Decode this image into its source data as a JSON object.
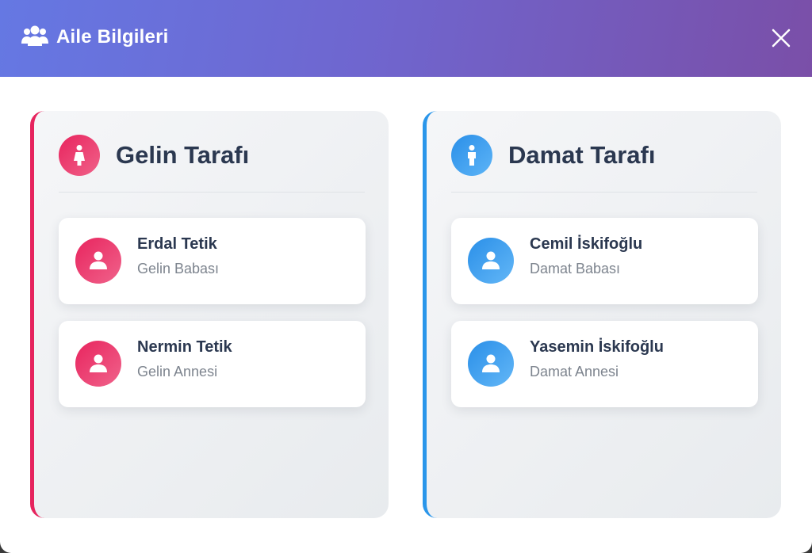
{
  "header": {
    "title": "Aile Bilgileri",
    "icon": "users-icon",
    "close_icon": "close-icon"
  },
  "bride_side": {
    "title": "Gelin Tarafı",
    "icon": "female-icon",
    "accent_color": "#e6245e",
    "members": [
      {
        "name": "Erdal Tetik",
        "role": "Gelin Babası",
        "icon": "user-icon"
      },
      {
        "name": "Nermin Tetik",
        "role": "Gelin Annesi",
        "icon": "user-icon"
      }
    ]
  },
  "groom_side": {
    "title": "Damat Tarafı",
    "icon": "male-icon",
    "accent_color": "#2a96ea",
    "members": [
      {
        "name": "Cemil İskifoğlu",
        "role": "Damat Babası",
        "icon": "user-icon"
      },
      {
        "name": "Yasemin İskifoğlu",
        "role": "Damat Annesi",
        "icon": "user-icon"
      }
    ]
  },
  "colors": {
    "header_gradient_start": "#6578e3",
    "header_gradient_end": "#7a4fa8",
    "text_primary": "#2b3850",
    "text_secondary": "#7d848e"
  }
}
